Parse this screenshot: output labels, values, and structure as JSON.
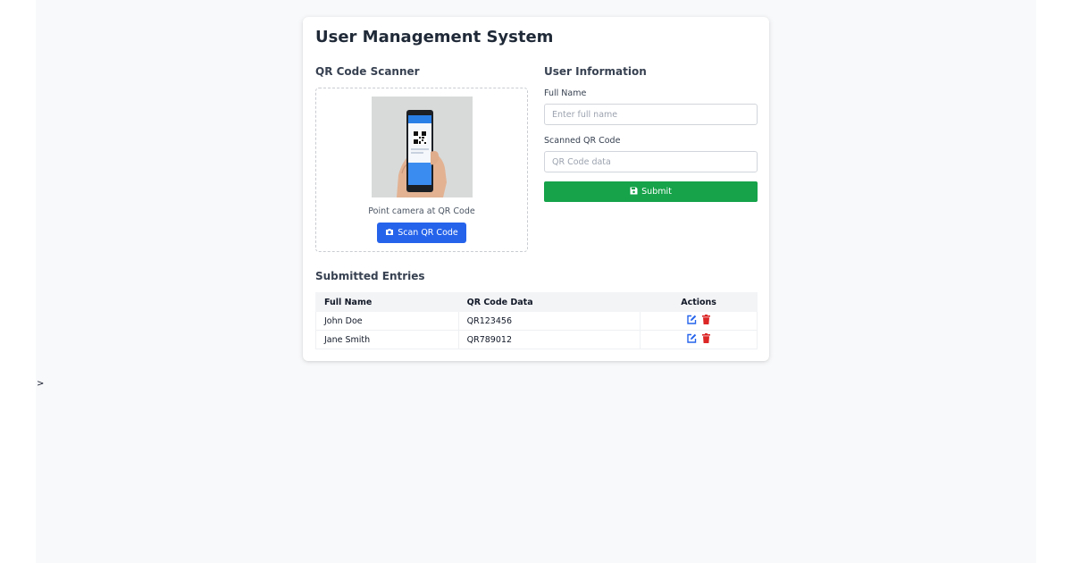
{
  "app": {
    "title": "User Management System"
  },
  "scanner": {
    "heading": "QR Code Scanner",
    "hint": "Point camera at QR Code",
    "scan_button": "Scan QR Code",
    "icon": "camera-icon"
  },
  "form": {
    "heading": "User Information",
    "full_name": {
      "label": "Full Name",
      "value": "",
      "placeholder": "Enter full name"
    },
    "qr_code": {
      "label": "Scanned QR Code",
      "value": "",
      "placeholder": "QR Code data"
    },
    "submit_label": "Submit",
    "submit_icon": "save-icon"
  },
  "entries": {
    "heading": "Submitted Entries",
    "columns": [
      "Full Name",
      "QR Code Data",
      "Actions"
    ],
    "rows": [
      {
        "name": "John Doe",
        "qr": "QR123456"
      },
      {
        "name": "Jane Smith",
        "qr": "QR789012"
      }
    ],
    "action_icons": [
      "edit-icon",
      "trash-icon"
    ]
  },
  "stray_text": ">",
  "colors": {
    "primary": "#2563eb",
    "success": "#16a34a",
    "danger": "#dc2626",
    "background": "#f8f9fb"
  }
}
